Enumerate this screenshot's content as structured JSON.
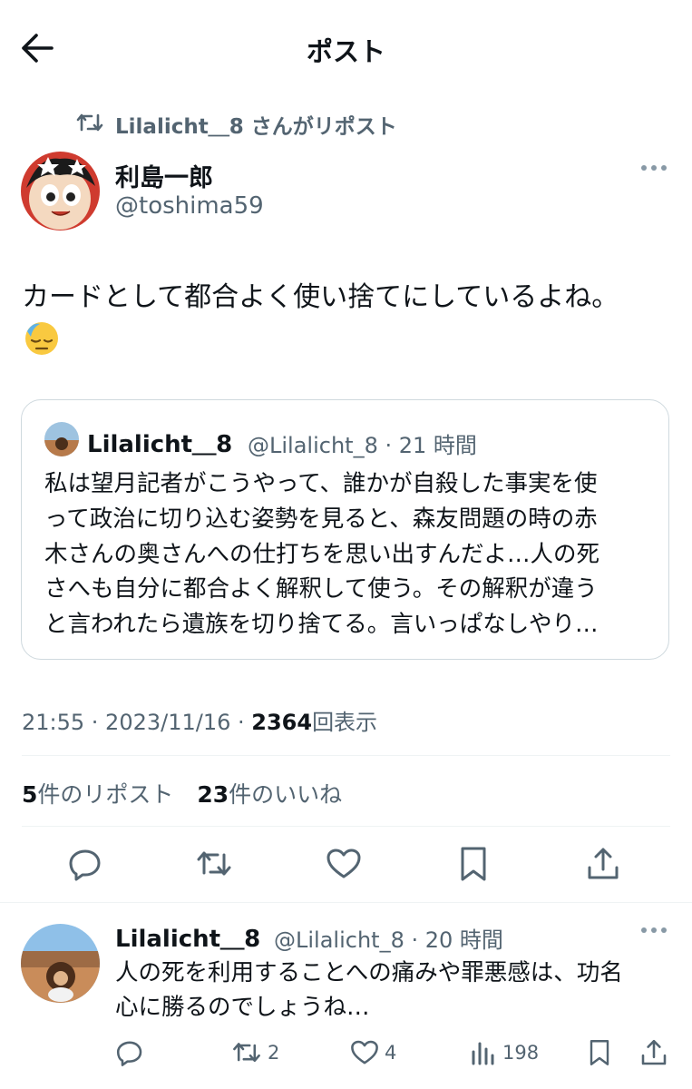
{
  "header": {
    "title": "ポスト"
  },
  "repost": {
    "text": "Lilalicht＿8 さんがリポスト"
  },
  "post": {
    "author_name": "利島一郎",
    "author_handle": "@toshima59",
    "text": "カードとして都合よく使い捨てにしているよね。",
    "emoji": "downcast-sweat-face",
    "timestamp": "21:55 · 2023/11/16 · ",
    "views": "2364",
    "views_label": "回表示",
    "reposts_count": "5",
    "reposts_label": "件のリポスト",
    "likes_count": "23",
    "likes_label": "件のいいね"
  },
  "quote": {
    "author_name": "Lilalicht＿8",
    "author_handle": "@Lilalicht_8 · 21 時間",
    "text": "私は望月記者がこうやって、誰かが自殺した事実を使\nって政治に切り込む姿勢を見ると、森友問題の時の赤\n木さんの奥さんへの仕打ちを思い出すんだよ…人の死\nさへも自分に都合よく解釈して使う。その解釈が違う\nと言われたら遺族を切り捨てる。言いっぱなしやり…"
  },
  "reply": {
    "author_name": "Lilalicht＿8",
    "author_handle": "@Lilalicht_8 · 20 時間",
    "text": "人の死を利用することへの痛みや罪悪感は、功名\n心に勝るのでしょうね…",
    "retweets": "2",
    "likes": "4",
    "views": "198"
  },
  "icons": [
    "back-arrow-icon",
    "retweet-icon",
    "more-icon",
    "reply-icon",
    "like-icon",
    "bookmark-icon",
    "share-icon",
    "views-icon"
  ],
  "colors": {
    "text": "#0f1419",
    "secondary": "#536471",
    "border": "#cfd9de",
    "divider": "#eff3f4"
  }
}
